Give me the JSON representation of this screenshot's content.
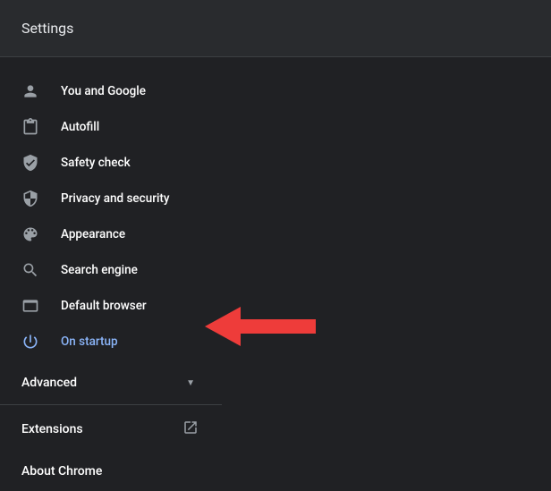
{
  "header": {
    "title": "Settings"
  },
  "sidebar": {
    "items": [
      {
        "icon": "person-icon",
        "label": "You and Google"
      },
      {
        "icon": "clipboard-icon",
        "label": "Autofill"
      },
      {
        "icon": "shield-check-icon",
        "label": "Safety check"
      },
      {
        "icon": "shield-icon",
        "label": "Privacy and security"
      },
      {
        "icon": "palette-icon",
        "label": "Appearance"
      },
      {
        "icon": "search-icon",
        "label": "Search engine"
      },
      {
        "icon": "browser-icon",
        "label": "Default browser"
      },
      {
        "icon": "power-icon",
        "label": "On startup"
      }
    ],
    "advanced_label": "Advanced",
    "extensions_label": "Extensions",
    "about_label": "About Chrome"
  },
  "selected_index": 7
}
